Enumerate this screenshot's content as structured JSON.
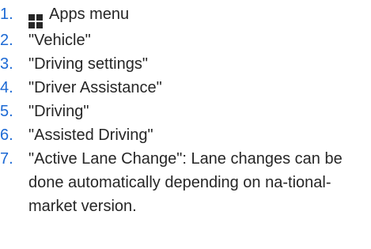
{
  "steps": [
    {
      "number": "1.",
      "icon": "apps-grid-icon",
      "text": "Apps menu"
    },
    {
      "number": "2.",
      "text": "\"Vehicle\""
    },
    {
      "number": "3.",
      "text": "\"Driving settings\""
    },
    {
      "number": "4.",
      "text": "\"Driver Assistance\""
    },
    {
      "number": "5.",
      "text": "\"Driving\""
    },
    {
      "number": "6.",
      "text": "\"Assisted Driving\""
    },
    {
      "number": "7.",
      "text": "\"Active Lane Change\": Lane changes can be done automatically depending on na-tional-market version."
    }
  ],
  "colors": {
    "step_number": "#1c69d4",
    "text": "#262626"
  }
}
